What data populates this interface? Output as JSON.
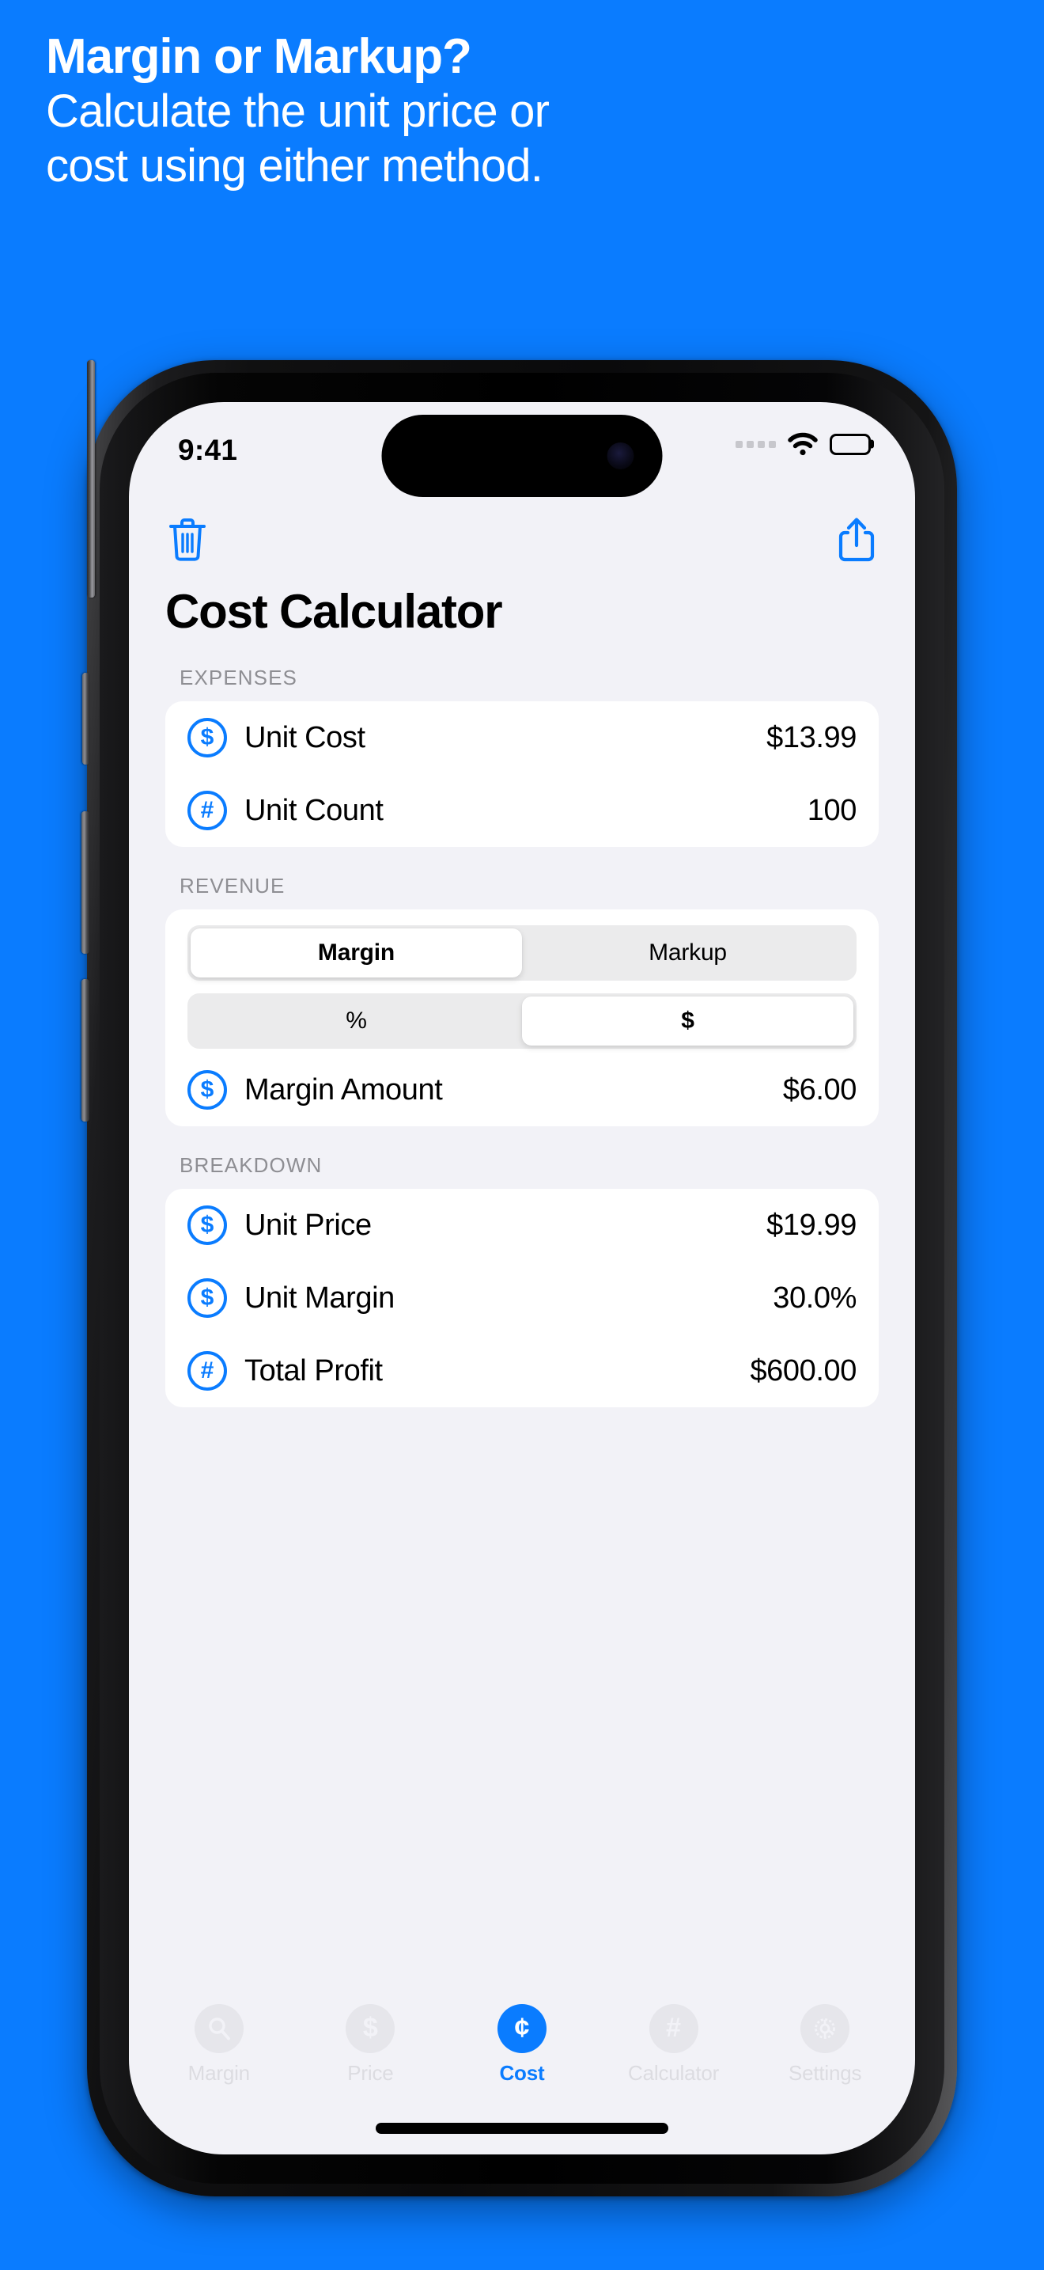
{
  "promo": {
    "title": "Margin or Markup?",
    "subtitle_line1": "Calculate the unit price or",
    "subtitle_line2": "cost using either method.",
    "background_color": "#0a7cff",
    "text_color": "#ffffff"
  },
  "status_bar": {
    "time": "9:41",
    "signal_icon": "signal-dots-icon",
    "wifi_icon": "wifi-icon",
    "battery_icon": "battery-icon"
  },
  "toolbar": {
    "delete_icon": "trash-icon",
    "share_icon": "share-icon",
    "accent_color": "#0a7cff"
  },
  "page_title": "Cost Calculator",
  "sections": [
    {
      "label": "EXPENSES",
      "rows": [
        {
          "icon": "dollar-circle-icon",
          "icon_glyph": "$",
          "label": "Unit Cost",
          "value": "$13.99"
        },
        {
          "icon": "hash-circle-icon",
          "icon_glyph": "#",
          "label": "Unit Count",
          "value": "100"
        }
      ]
    },
    {
      "label": "REVENUE",
      "segment_method": {
        "options": [
          "Margin",
          "Markup"
        ],
        "selected": "Margin"
      },
      "segment_unit": {
        "options": [
          "%",
          "$"
        ],
        "selected": "$"
      },
      "rows": [
        {
          "icon": "dollar-circle-icon",
          "icon_glyph": "$",
          "label": "Margin Amount",
          "value": "$6.00"
        }
      ]
    },
    {
      "label": "BREAKDOWN",
      "rows": [
        {
          "icon": "dollar-circle-icon",
          "icon_glyph": "$",
          "label": "Unit Price",
          "value": "$19.99"
        },
        {
          "icon": "dollar-circle-icon",
          "icon_glyph": "$",
          "label": "Unit Margin",
          "value": "30.0%"
        },
        {
          "icon": "hash-circle-icon",
          "icon_glyph": "#",
          "label": "Total Profit",
          "value": "$600.00"
        }
      ]
    }
  ],
  "tab_bar": {
    "active": "Cost",
    "active_color": "#0a7cff",
    "items": [
      {
        "label": "Margin",
        "icon": "magnifier-icon",
        "glyph": "⚲"
      },
      {
        "label": "Price",
        "icon": "dollar-icon",
        "glyph": "$"
      },
      {
        "label": "Cost",
        "icon": "cent-icon",
        "glyph": "¢"
      },
      {
        "label": "Calculator",
        "icon": "hash-icon",
        "glyph": "#"
      },
      {
        "label": "Settings",
        "icon": "gear-icon",
        "glyph": "⚙"
      }
    ]
  }
}
